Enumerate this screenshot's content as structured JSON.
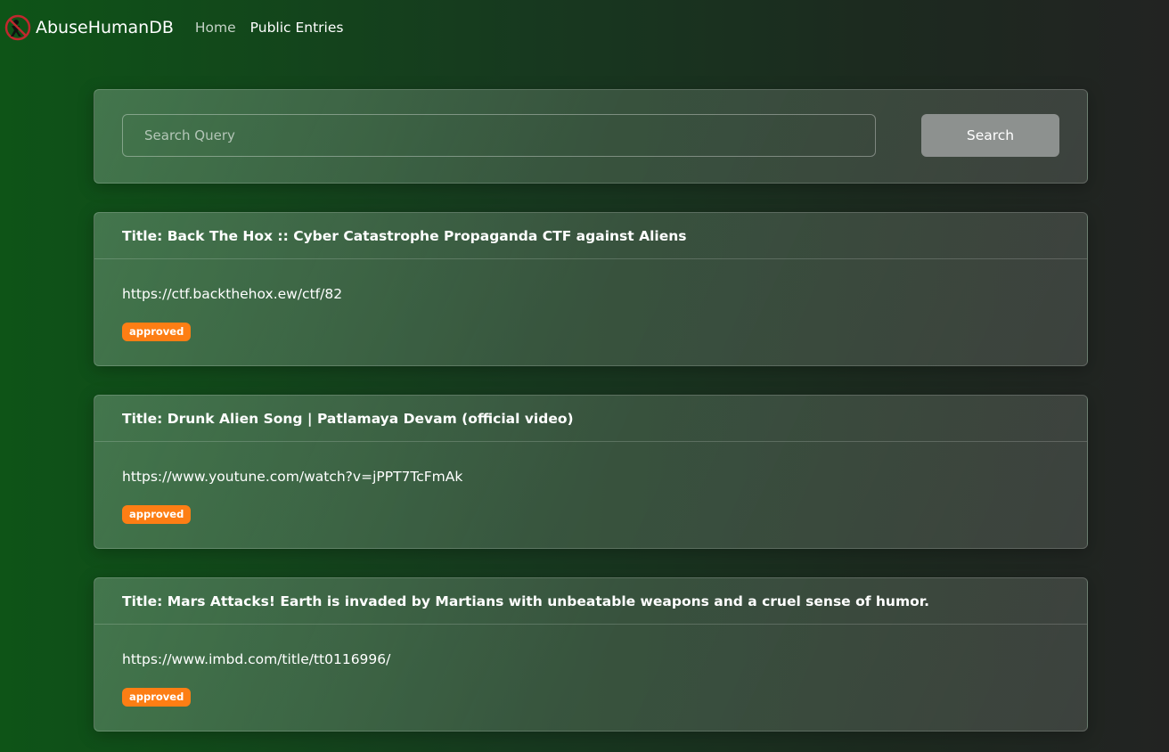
{
  "navbar": {
    "brand": "AbuseHumanDB",
    "links": [
      {
        "label": "Home"
      },
      {
        "label": "Public Entries"
      }
    ]
  },
  "search": {
    "placeholder": "Search Query",
    "value": "",
    "button_label": "Search"
  },
  "entries": [
    {
      "title": "Title: Back The Hox :: Cyber Catastrophe Propaganda CTF against Aliens",
      "url": "https://ctf.backthehox.ew/ctf/82",
      "status": "approved"
    },
    {
      "title": "Title: Drunk Alien Song | Patlamaya Devam (official video)",
      "url": "https://www.youtune.com/watch?v=jPPT7TcFmAk",
      "status": "approved"
    },
    {
      "title": "Title: Mars Attacks! Earth is invaded by Martians with unbeatable weapons and a cruel sense of humor.",
      "url": "https://www.imbd.com/title/tt0116996/",
      "status": "approved"
    }
  ],
  "colors": {
    "badge": "#fd7e14",
    "logo_ring": "#c0282e",
    "search_button": "#8d918f"
  },
  "icons": {
    "brand_logo": "no-human-icon"
  }
}
